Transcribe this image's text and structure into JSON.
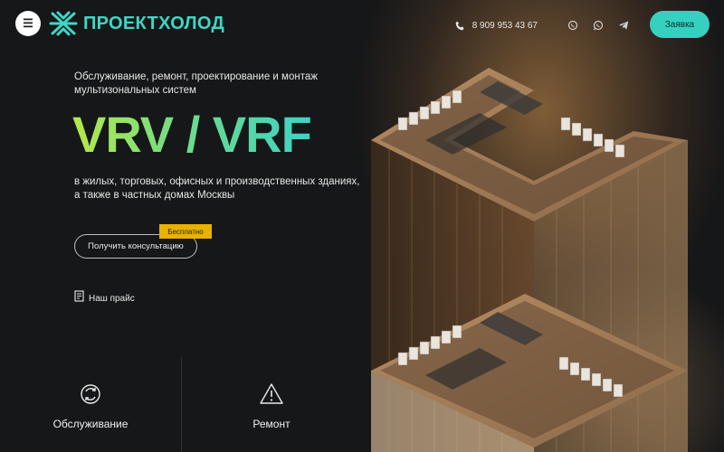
{
  "header": {
    "menu_icon": "hamburger-icon",
    "logo_icon": "snowflake-icon",
    "logo_text": "ПРОЕКТХОЛОД",
    "phone": "8 909 953 43 67",
    "messengers": [
      "viber-icon",
      "whatsapp-icon",
      "telegram-icon"
    ],
    "request_button": "Заявка",
    "accent_color": "#35d0c0"
  },
  "hero": {
    "subtitle": "Обслуживание, ремонт, проектирование и монтаж мультизональных систем",
    "title": "VRV / VRF",
    "description": "в жилых, торговых, офисных и производственных зданиях, а также в частных домах Москвы",
    "consult_button": "Получить консультацию",
    "free_badge": "Бесплатно",
    "price_link": "Наш прайс"
  },
  "cards": [
    {
      "label": "Обслуживание",
      "icon": "refresh-cycle-icon"
    },
    {
      "label": "Ремонт",
      "icon": "warning-triangle-icon"
    }
  ],
  "colors": {
    "background": "#161718",
    "gradient_start": "#b6e84a",
    "gradient_end": "#3ed2c4",
    "badge": "#e8b200"
  }
}
